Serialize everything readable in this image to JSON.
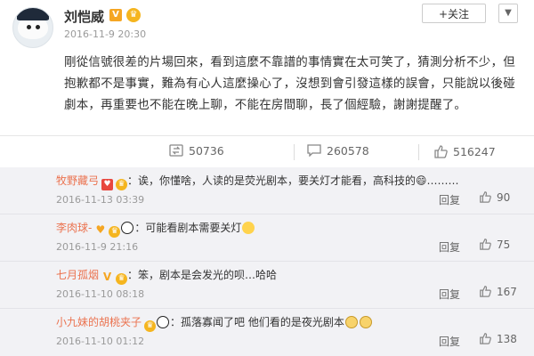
{
  "post": {
    "username": "刘恺威",
    "verified_badge": "V",
    "timestamp": "2016-11-9 20:30",
    "follow_label": "+关注",
    "text": "剛從信號很差的片場回來，看到這麼不靠譜的事情實在太可笑了，猜測分析不少，但抱歉都不是事實，難為有心人這麼操心了，沒想到會引發這樣的誤會，只能說以後碰劇本，再重要也不能在晚上聊，不能在房間聊，長了個經驗，謝謝提醒了。",
    "actions": {
      "repost_count": "50736",
      "comment_count": "260578",
      "like_count": "516247"
    }
  },
  "comments": [
    {
      "user": "牧野藏弓",
      "text": "：诶，你懂啥，人读的是荧光剧本，要关灯才能看，高科技的😄………",
      "time": "2016-11-13 03:39",
      "reply_label": "回复",
      "likes": "90"
    },
    {
      "user": "李肉球-",
      "text": "：可能看剧本需要关灯",
      "time": "2016-11-9 21:16",
      "reply_label": "回复",
      "likes": "75"
    },
    {
      "user": "七月孤烟",
      "text": "：笨，剧本是会发光的呗…哈哈",
      "time": "2016-11-10 08:18",
      "reply_label": "回复",
      "likes": "167"
    },
    {
      "user": "小九妹的胡桃夹子",
      "text": "：孤落寡闻了吧 他们看的是夜光剧本",
      "time": "2016-11-10 01:12",
      "reply_label": "回复",
      "likes": "138"
    }
  ],
  "colors": {
    "accent_orange": "#eb7350",
    "badge_gold": "#f5b51f",
    "comments_bg": "#f2f2f5"
  },
  "icons": {
    "repost": "repost-icon",
    "comment": "comment-icon",
    "like": "thumbs-up-icon",
    "menu": "chevron-down-icon"
  }
}
